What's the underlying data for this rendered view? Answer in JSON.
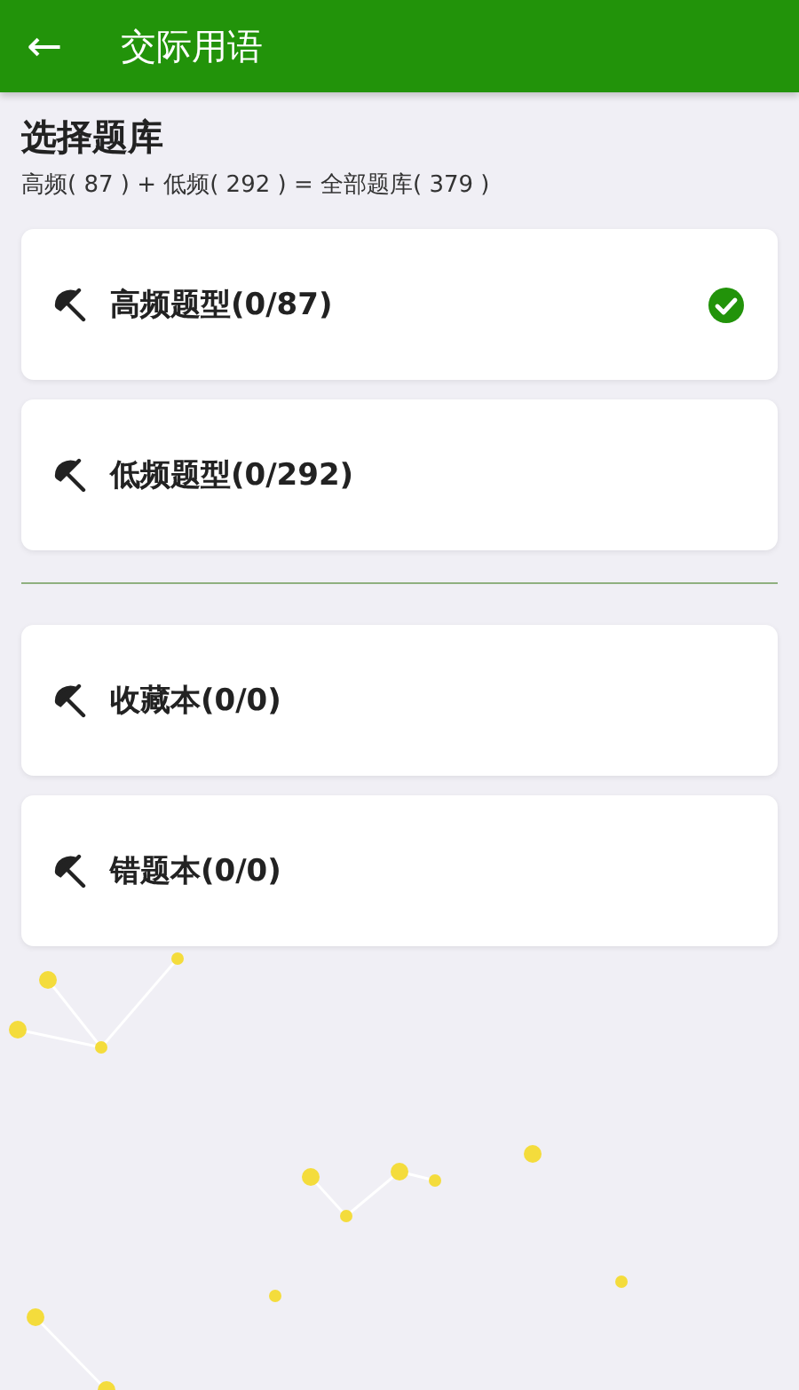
{
  "app_bar": {
    "back_icon": "←",
    "title": "交际用语"
  },
  "heading": {
    "title": "选择题库",
    "summary": "高频( 87 ) + 低频( 292 ) = 全部题库( 379 )"
  },
  "question_banks": [
    {
      "label": "高频题型(0/87)",
      "selected": true
    },
    {
      "label": "低频题型(0/292)",
      "selected": false
    }
  ],
  "notebooks": [
    {
      "label": "收藏本(0/0)"
    },
    {
      "label": "错题本(0/0)"
    }
  ]
}
